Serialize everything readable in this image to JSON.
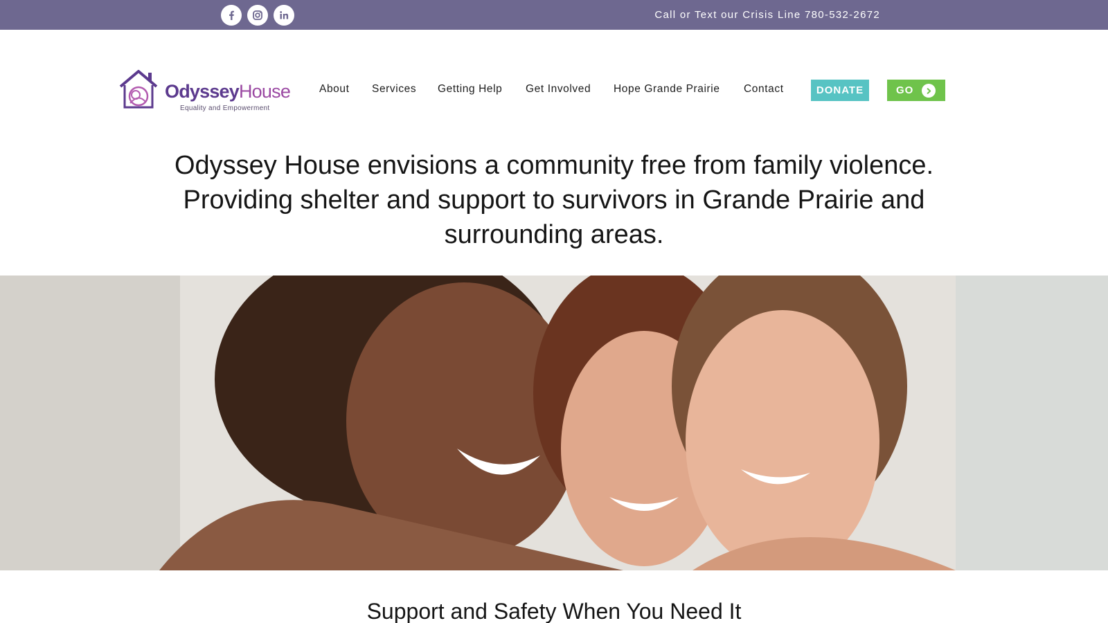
{
  "topbar": {
    "social": [
      {
        "icon": "facebook-icon"
      },
      {
        "icon": "instagram-icon"
      },
      {
        "icon": "linkedin-icon"
      }
    ],
    "crisis_line": "Call or Text our Crisis Line 780-532-2672"
  },
  "logo": {
    "word_1": "Odyssey",
    "word_2": "House",
    "tagline": "Equality and Empowerment"
  },
  "nav": {
    "items": [
      "About",
      "Services",
      "Getting Help",
      "Get Involved",
      "Hope Grande Prairie",
      "Contact"
    ]
  },
  "buttons": {
    "donate": "DONATE",
    "go": "GO"
  },
  "mission_text": "Odyssey House envisions a community free from family violence. Providing shelter and support to survivors in Grande Prairie and surrounding areas.",
  "hero": {
    "image_icon": "hero-photo"
  },
  "section": {
    "title": "Support and Safety When You Need It"
  },
  "colors": {
    "topbar": "#6e6890",
    "donate": "#57c3c3",
    "go": "#6fc34b",
    "logo_primary": "#5c3a8e",
    "logo_secondary": "#9b4aa3"
  }
}
